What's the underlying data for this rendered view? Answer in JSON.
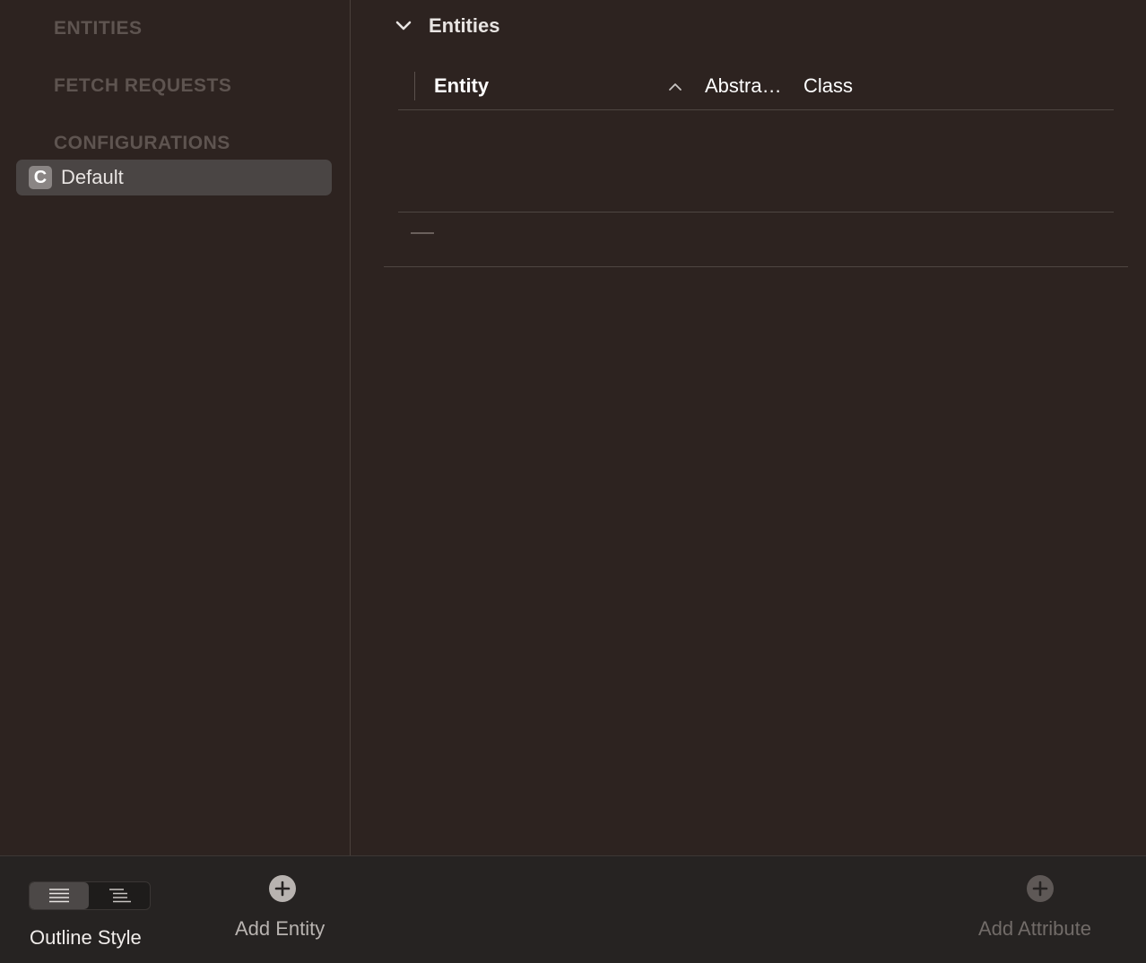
{
  "sidebar": {
    "sections": {
      "entities": "ENTITIES",
      "fetch_requests": "FETCH REQUESTS",
      "configurations": "CONFIGURATIONS"
    },
    "configuration_items": [
      {
        "badge": "C",
        "label": "Default",
        "selected": true
      }
    ]
  },
  "main": {
    "section_title": "Entities",
    "table": {
      "columns": [
        "Entity",
        "Abstra…",
        "Class"
      ],
      "sort_column": "Entity",
      "sort_direction": "ascending",
      "rows": []
    }
  },
  "toolbar": {
    "outline_style_label": "Outline Style",
    "add_entity_label": "Add Entity",
    "add_attribute_label": "Add Attribute",
    "add_attribute_enabled": false
  },
  "colors": {
    "background": "#2d2320",
    "toolbar_background": "#262322",
    "selection": "#4a4544",
    "section_header": "#5e5450"
  }
}
